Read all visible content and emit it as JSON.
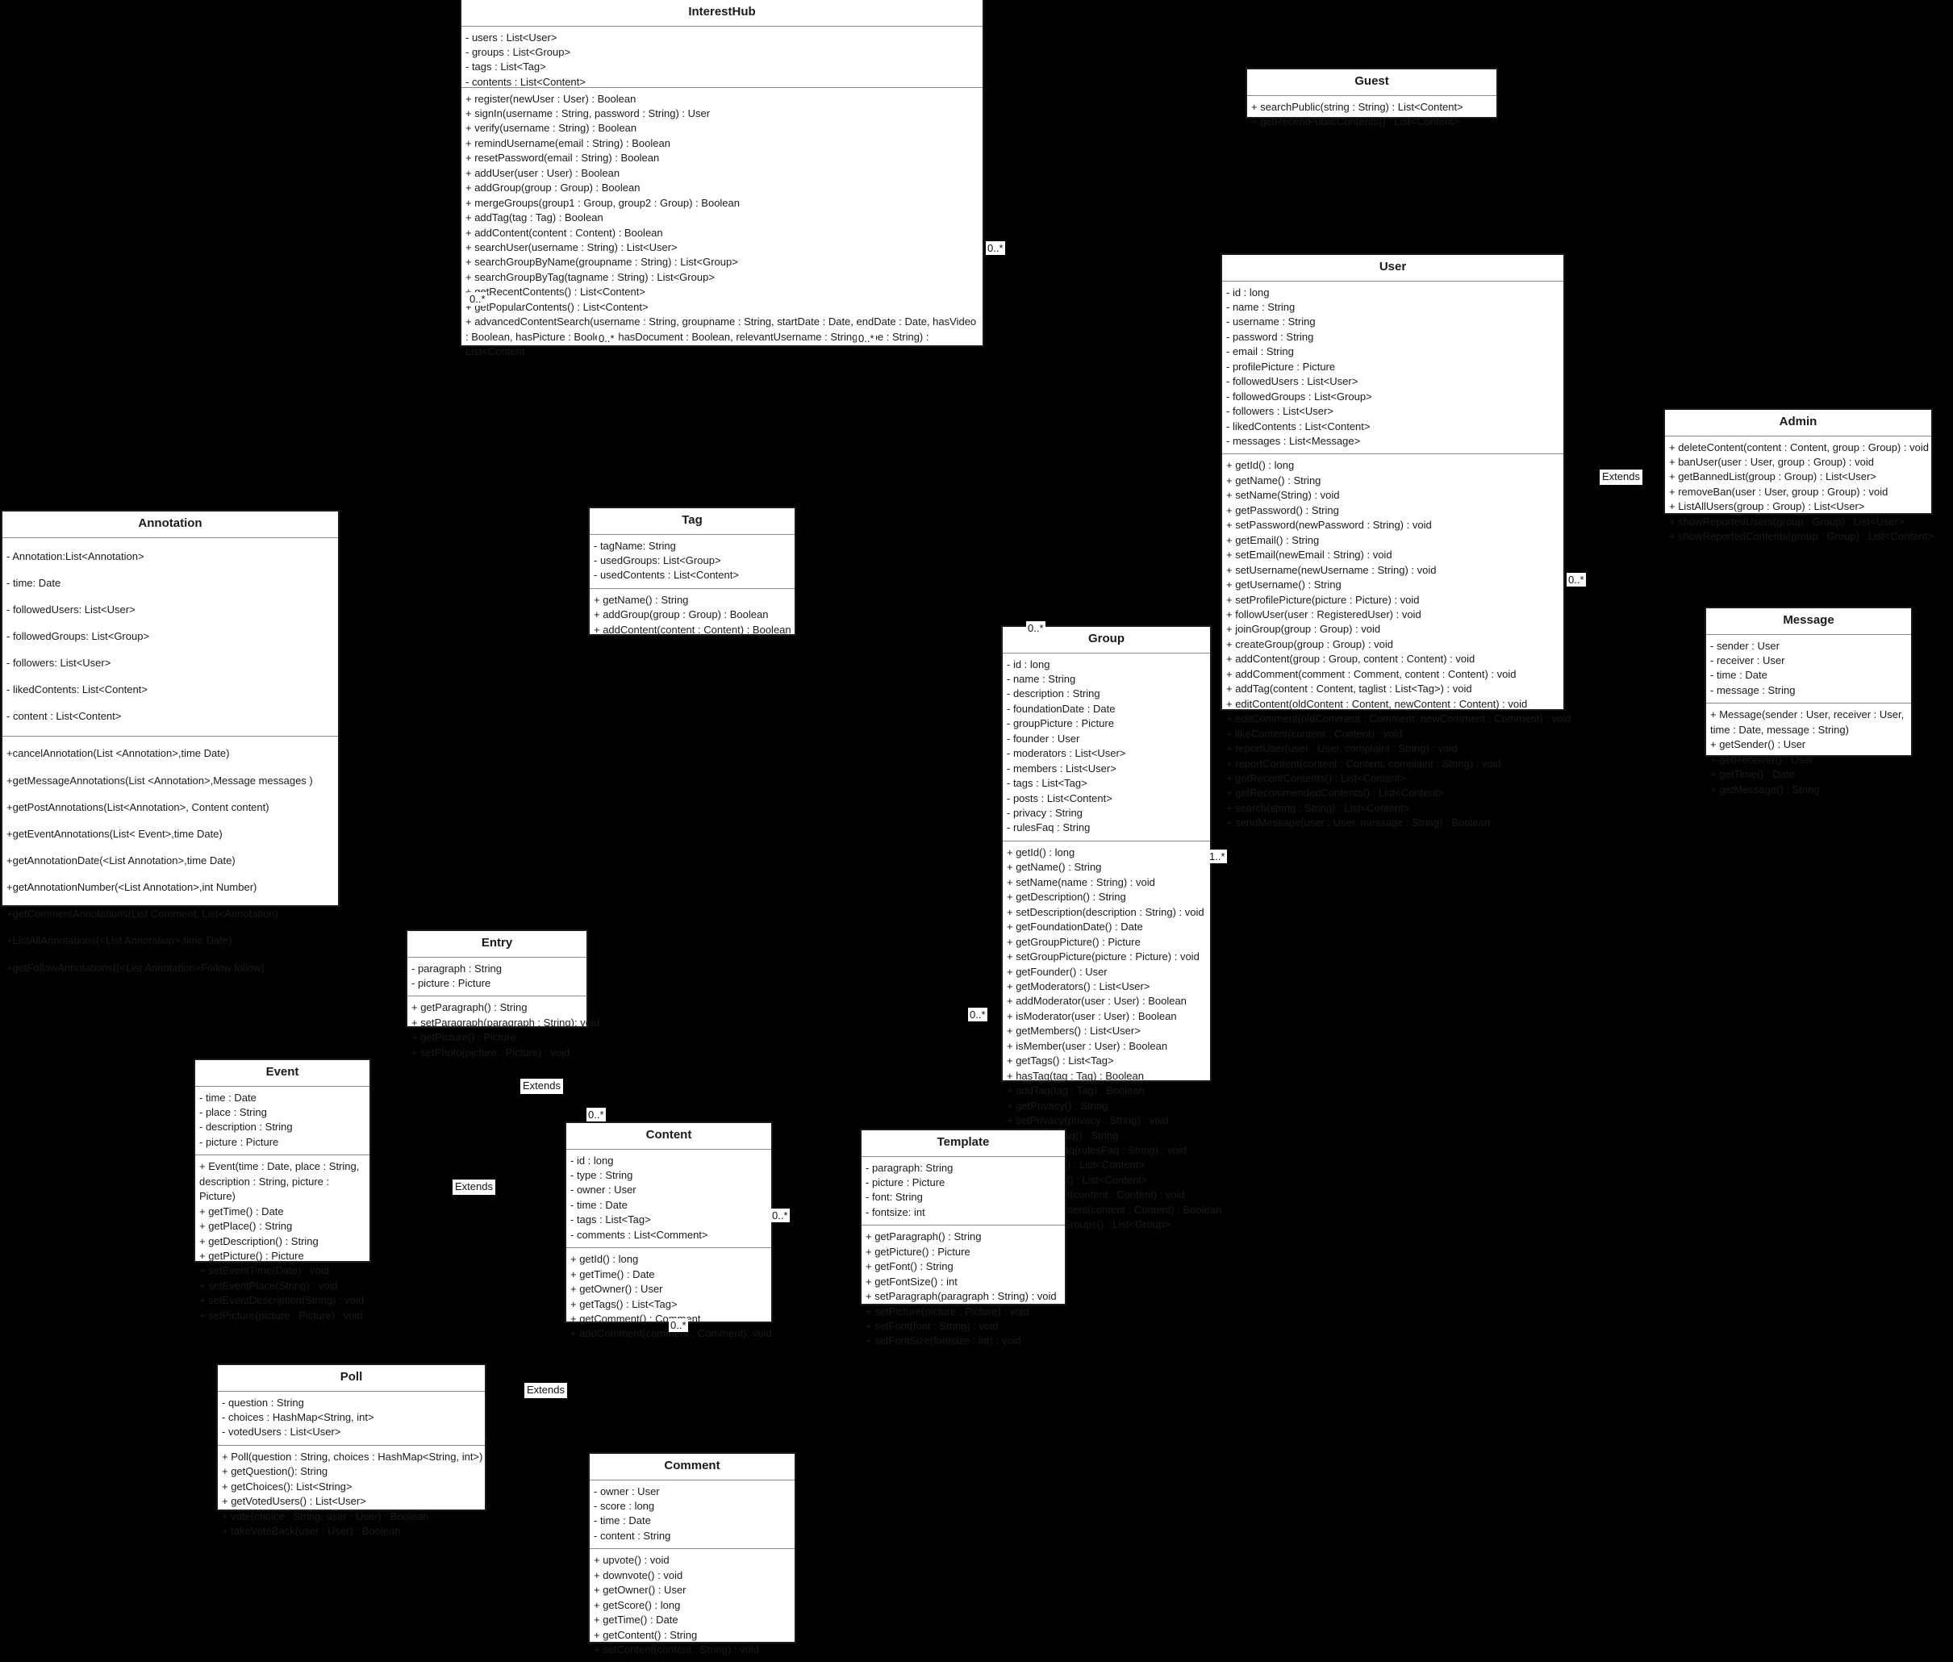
{
  "diagram": {
    "kind": "uml-class-diagram",
    "background": "#000000",
    "box_fill": "#ffffff",
    "box_stroke": "#1a1a1a"
  },
  "classes": {
    "interesthub": {
      "name": "InterestHub",
      "attributes": [
        "- users : List<User>",
        "- groups : List<Group>",
        "- tags : List<Tag>",
        "- contents : List<Content>"
      ],
      "methods": [
        "+ register(newUser : User) : Boolean",
        "+ signIn(username : String, password : String) : User",
        "+ verify(username : String) : Boolean",
        "+ remindUsername(email : String) : Boolean",
        "+ resetPassword(email : String) : Boolean",
        "+ addUser(user : User) : Boolean",
        "+ addGroup(group : Group) : Boolean",
        "+ mergeGroups(group1 : Group, group2 : Group) : Boolean",
        "+ addTag(tag : Tag) : Boolean",
        "+ addContent(content : Content) : Boolean",
        "+ searchUser(username : String) : List<User>",
        "+ searchGroupByName(groupname : String) : List<Group>",
        "+ searchGroupByTag(tagname : String) : List<Group>",
        "+ getRecentContents() : List<Content>",
        "+ getPopularContents() : List<Content>",
        "+ advancedContentSearch(username : String, groupname : String, startDate : Date, endDate : Date, hasVideo : Boolean, hasPicture : Boolean, hasDocument : Boolean, relevantUsername : String, type : String) : List<Content"
      ]
    },
    "guest": {
      "name": "Guest",
      "attributes": [],
      "methods": [
        "+ searchPublic(string : String) : List<Content>",
        "+ getRecentPublicContents() : List<Content>"
      ]
    },
    "user": {
      "name": "User",
      "attributes": [
        "- id : long",
        "- name : String",
        "- username : String",
        "- password : String",
        "- email : String",
        "- profilePicture : Picture",
        "- followedUsers : List<User>",
        "- followedGroups : List<Group>",
        "- followers : List<User>",
        "- likedContents : List<Content>",
        "- messages : List<Message>"
      ],
      "methods": [
        "+ getId() : long",
        "+ getName() : String",
        "+ setName(String) : void",
        "+ getPassword() : String",
        "+ setPassword(newPassword : String) : void",
        "+ getEmail() : String",
        "+ setEmail(newEmail : String) : void",
        "+ setUsername(newUsername : String) : void",
        "+ getUsername() : String",
        "+ setProfilePicture(picture : Picture) : void",
        "+ followUser(user : RegisteredUser) : void",
        "+ joinGroup(group : Group) : void",
        "+ createGroup(group : Group) : void",
        "+ addContent(group : Group, content : Content) : void",
        "+ addComment(comment : Comment, content : Content) : void",
        "+ addTag(content : Content, taglist : List<Tag>) : void",
        "+ editContent(oldContent : Content, newContent : Content) : void",
        "+ editComment(oldComment : Comment, newComment : Comment) : void",
        "+ likeContent(content : Content) : void",
        "+ reportUser(user : User, complaint : String) : void",
        "+ reportContent(content : Content, complaint : String) : void",
        "+ getRecentContents() : List<Content>",
        "+ getRecommendedContents() : List<Content>",
        "+ search(string : String) : List<Content>",
        "+ sendMessage(user : User, message : String) : Boolean"
      ]
    },
    "admin": {
      "name": "Admin",
      "attributes": [],
      "methods": [
        "+ deleteContent(content : Content, group : Group) : void",
        "+ banUser(user : User, group : Group) : void",
        "+ getBannedList(group : Group) : List<User>",
        "+ removeBan(user : User, group : Group) : void",
        "+ ListAllUsers(group : Group) : List<User>",
        "+ showReportedUsers(group : Group) : List<User>",
        "+ showReportedContents(group : Group) : List<Content>"
      ]
    },
    "message": {
      "name": "Message",
      "attributes": [
        "- sender : User",
        "- receiver : User",
        "- time : Date",
        "- message : String"
      ],
      "methods": [
        "+ Message(sender : User, receiver : User, time : Date, message : String)",
        "+ getSender() : User",
        "+ getReceiver() : User",
        "+ getTime() : Date",
        "+ getMessage() : String"
      ]
    },
    "annotation": {
      "name": "Annotation",
      "attributes": [
        "- Annotation:List<Annotation>",
        "- time: Date",
        "- followedUsers: List<User>",
        "- followedGroups: List<Group>",
        "- followers: List<User>",
        "- likedContents: List<Content>",
        "- content : List<Content>"
      ],
      "methods": [
        "+cancelAnnotation(List <Annotation>,time Date)",
        "+getMessageAnnotations(List <Annotation>,Message messages )",
        "+getPostAnnotations(List<Annotation>, Content content)",
        "+getEventAnnotations(List< Event>,time Date)",
        "+getAnnotationDate(<List Annotation>,time Date)",
        "+getAnnotationNumber(<List Annotation>,int Number)",
        "+getCommentAnnotations(List Comment, List<Annotation)",
        "+ListAllAnnotations(<List Annotation>,time Date)",
        "+getFollowAnnotations((<List Annotation>Follow follow)"
      ]
    },
    "tag": {
      "name": "Tag",
      "attributes": [
        "- tagName: String",
        "- usedGroups: List<Group>",
        "- usedContents : List<Content>"
      ],
      "methods": [
        "+ getName() : String",
        "+ addGroup(group : Group) : Boolean",
        "+ addContent(content : Content) : Boolean"
      ]
    },
    "group": {
      "name": "Group",
      "attributes": [
        "- id : long",
        "- name : String",
        "- description : String",
        "- foundationDate : Date",
        "- groupPicture : Picture",
        "- founder : User",
        "- moderators : List<User>",
        "- members : List<User>",
        "- tags : List<Tag>",
        "- posts : List<Content>",
        "- privacy : String",
        "- rulesFaq : String"
      ],
      "methods": [
        "+ getId() : long",
        "+ getName() : String",
        "+ setName(name : String) : void",
        "+ getDescription() : String",
        "+ setDescription(description : String) : void",
        "+ getFoundationDate() : Date",
        "+ getGroupPicture() : Picture",
        "+ setGroupPicture(picture : Picture) : void",
        "+ getFounder() : User",
        "+ getModerators() : List<User>",
        "+ addModerator(user : User) : Boolean",
        "+ isModerator(user : User) : Boolean",
        "+ getMembers() : List<User>",
        "+ isMember(user : User) : Boolean",
        "+ getTags() : List<Tag>",
        "+ hasTag(tag : Tag) : Boolean",
        "+ addTag(tag : Tag) : Boolean",
        "+ getPrivacy() : String",
        "+ setPrivacy(privacy : String) : void",
        "+ getRulesFaq() : String",
        "+ setRulesFaq(rulesFaq : String) : void",
        "+ getRecent() : List<Content>",
        "+ getPopular() : List<Content>",
        "+ addContent(content : Content) : void",
        "+ removeContent(content : Content) : Boolean",
        "+ getSimilarGroups() : List<Group>"
      ]
    },
    "entry": {
      "name": "Entry",
      "attributes": [
        "- paragraph : String",
        "- picture : Picture"
      ],
      "methods": [
        "+ getParagraph() : String",
        "+ setParagraph(paragraph : String): void",
        "+ getPicture() : Picture",
        "+ setPhoto(picture : Picture) : void"
      ]
    },
    "event": {
      "name": "Event",
      "attributes": [
        "- time : Date",
        "- place : String",
        "- description : String",
        "- picture : Picture"
      ],
      "methods": [
        "+ Event(time : Date, place : String, description : String, picture : Picture)",
        "+ getTime() : Date",
        "+ getPlace() : String",
        "+ getDescription() : String",
        "+ getPicture() : Picture",
        "+ setEventTime(Date) : void",
        "+ setEventPlace(String) : void",
        "+ setEventDescription(String) : void",
        "+ setPicture(picture : Picture) : void"
      ]
    },
    "content": {
      "name": "Content",
      "attributes": [
        "- id : long",
        "- type : String",
        "- owner : User",
        "- time : Date",
        "- tags : List<Tag>",
        "- comments : List<Comment>"
      ],
      "methods": [
        "+ getId() : long",
        "+ getTime() : Date",
        "+ getOwner() : User",
        "+ getTags() : List<Tag>",
        "+ getComment() : Comment",
        "+ addComment(comment : Comment): void"
      ]
    },
    "template": {
      "name": "Template",
      "attributes": [
        "- paragraph: String",
        "- picture : Picture",
        "- font: String",
        "- fontsize: int"
      ],
      "methods": [
        "+ getParagraph() : String",
        "+ getPicture() : Picture",
        "+ getFont() : String",
        "+ getFontSize() : int",
        "+ setParagraph(paragraph : String) : void",
        "+ setPicture(picture : Picture) : void",
        "+ setFont(font : String) : void",
        "+ setFontSize(fontsize : int) : void"
      ]
    },
    "poll": {
      "name": "Poll",
      "attributes": [
        "- question : String",
        "- choices : HashMap<String, int>",
        "- votedUsers : List<User>"
      ],
      "methods": [
        "+ Poll(question : String, choices : HashMap<String, int>)",
        "+ getQuestion(): String",
        "+ getChoices(): List<String>",
        "+ getVotedUsers() : List<User>",
        "+ vote(choice : String, user : User) : Boolean",
        "+ takeVoteBack(user : User) : Boolean"
      ]
    },
    "comment": {
      "name": "Comment",
      "attributes": [
        "- owner : User",
        "- score : long",
        "- time : Date",
        "- content : String"
      ],
      "methods": [
        "+ upvote() : void",
        "+ downvote() : void",
        "+ getOwner() : User",
        "+ getScore() : long",
        "+ getTime() : Date",
        "+ getContent() : String",
        "+ setContent(content : String) : void"
      ]
    }
  },
  "relationship_labels": [
    {
      "id": "extends-user-admin",
      "text": "Extends"
    },
    {
      "id": "extends-entry-content",
      "text": "Extends"
    },
    {
      "id": "extends-event-content",
      "text": "Extends"
    },
    {
      "id": "extends-poll-content",
      "text": "Extends"
    }
  ],
  "multiplicities": [
    {
      "id": "hub-user-right",
      "text": "0..*"
    },
    {
      "id": "hub-bottom-left",
      "text": "0..*"
    },
    {
      "id": "hub-bottom-mid",
      "text": "0..*"
    },
    {
      "id": "hub-bottom-right",
      "text": "0..*"
    },
    {
      "id": "user-right",
      "text": "0..*"
    },
    {
      "id": "group-top",
      "text": "0..*"
    },
    {
      "id": "group-right",
      "text": "1..*"
    },
    {
      "id": "group-bottom-left",
      "text": "0..*"
    },
    {
      "id": "content-top",
      "text": "0..*"
    },
    {
      "id": "content-right",
      "text": "0..*"
    },
    {
      "id": "content-bottom",
      "text": "0..*"
    }
  ]
}
